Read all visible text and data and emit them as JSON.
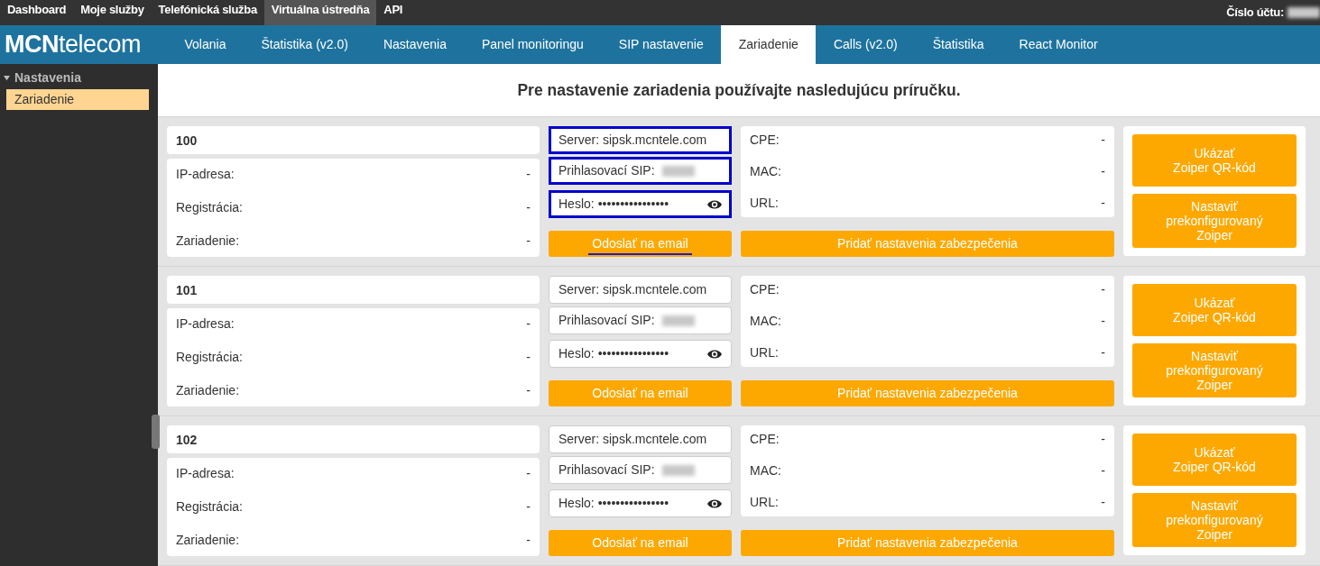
{
  "top_menu": [
    {
      "label": "Dashboard",
      "selected": false
    },
    {
      "label": "Moje služby",
      "selected": false
    },
    {
      "label": "Telefónická služba",
      "selected": false
    },
    {
      "label": "Virtuálna ústredňa",
      "selected": true
    },
    {
      "label": "API",
      "selected": false
    }
  ],
  "account_label": "Číslo účtu:",
  "logo": {
    "bold": "MCN",
    "rest": "telecom"
  },
  "main_tabs": [
    {
      "label": "Volania",
      "selected": false
    },
    {
      "label": "Štatistika (v2.0)",
      "selected": false
    },
    {
      "label": "Nastavenia",
      "selected": false
    },
    {
      "label": "Panel monitoringu",
      "selected": false
    },
    {
      "label": "SIP nastavenie",
      "selected": false
    },
    {
      "label": "Zariadenie",
      "selected": true
    },
    {
      "label": "Calls (v2.0)",
      "selected": false
    },
    {
      "label": "Štatistika",
      "selected": false
    },
    {
      "label": "React Monitor",
      "selected": false
    }
  ],
  "sidebar": {
    "group": "Nastavenia",
    "expanded": true,
    "items": [
      {
        "label": "Zariadenie",
        "selected": true
      }
    ]
  },
  "heading": "Pre nastavenie zariadenia používajte nasledujúcu príručku.",
  "devices": [
    {
      "number": "100",
      "status": [
        {
          "label": "IP-adresa:",
          "value": "-"
        },
        {
          "label": "Registrácia:",
          "value": "-"
        },
        {
          "label": "Zariadenie:",
          "value": "-"
        }
      ],
      "server": {
        "label": "Server:",
        "value": "sipsk.mcntele.com",
        "highlighted": true
      },
      "sip_login": {
        "label": "Prihlasovací SIP:",
        "highlighted": true
      },
      "password": {
        "label": "Heslo:",
        "value": "••••••••••••••••",
        "highlighted": true
      },
      "email_button": {
        "label": "Odoslať na email",
        "underlined": true
      },
      "cpe": [
        {
          "label": "CPE:",
          "value": "-"
        },
        {
          "label": "MAC:",
          "value": "-"
        },
        {
          "label": "URL:",
          "value": "-"
        }
      ],
      "security_button": "Pridať nastavenia zabezpečenia",
      "qr_button": [
        "Ukázať",
        "Zoiper QR-kód"
      ],
      "zoiper_button": [
        "Nastaviť",
        "prekonfigurovaný",
        "Zoiper"
      ]
    },
    {
      "number": "101",
      "status": [
        {
          "label": "IP-adresa:",
          "value": "-"
        },
        {
          "label": "Registrácia:",
          "value": "-"
        },
        {
          "label": "Zariadenie:",
          "value": "-"
        }
      ],
      "server": {
        "label": "Server:",
        "value": "sipsk.mcntele.com",
        "highlighted": false
      },
      "sip_login": {
        "label": "Prihlasovací SIP:",
        "highlighted": false
      },
      "password": {
        "label": "Heslo:",
        "value": "••••••••••••••••",
        "highlighted": false
      },
      "email_button": {
        "label": "Odoslať na email",
        "underlined": false
      },
      "cpe": [
        {
          "label": "CPE:",
          "value": "-"
        },
        {
          "label": "MAC:",
          "value": "-"
        },
        {
          "label": "URL:",
          "value": "-"
        }
      ],
      "security_button": "Pridať nastavenia zabezpečenia",
      "qr_button": [
        "Ukázať",
        "Zoiper QR-kód"
      ],
      "zoiper_button": [
        "Nastaviť",
        "prekonfigurovaný",
        "Zoiper"
      ]
    },
    {
      "number": "102",
      "status": [
        {
          "label": "IP-adresa:",
          "value": "-"
        },
        {
          "label": "Registrácia:",
          "value": "-"
        },
        {
          "label": "Zariadenie:",
          "value": "-"
        }
      ],
      "server": {
        "label": "Server:",
        "value": "sipsk.mcntele.com",
        "highlighted": false
      },
      "sip_login": {
        "label": "Prihlasovací SIP:",
        "highlighted": false
      },
      "password": {
        "label": "Heslo:",
        "value": "••••••••••••••••",
        "highlighted": false
      },
      "email_button": {
        "label": "Odoslať na email",
        "underlined": false
      },
      "cpe": [
        {
          "label": "CPE:",
          "value": "-"
        },
        {
          "label": "MAC:",
          "value": "-"
        },
        {
          "label": "URL:",
          "value": "-"
        }
      ],
      "security_button": "Pridať nastavenia zabezpečenia",
      "qr_button": [
        "Ukázať",
        "Zoiper QR-kód"
      ],
      "zoiper_button": [
        "Nastaviť",
        "prekonfigurovaný",
        "Zoiper"
      ]
    }
  ]
}
